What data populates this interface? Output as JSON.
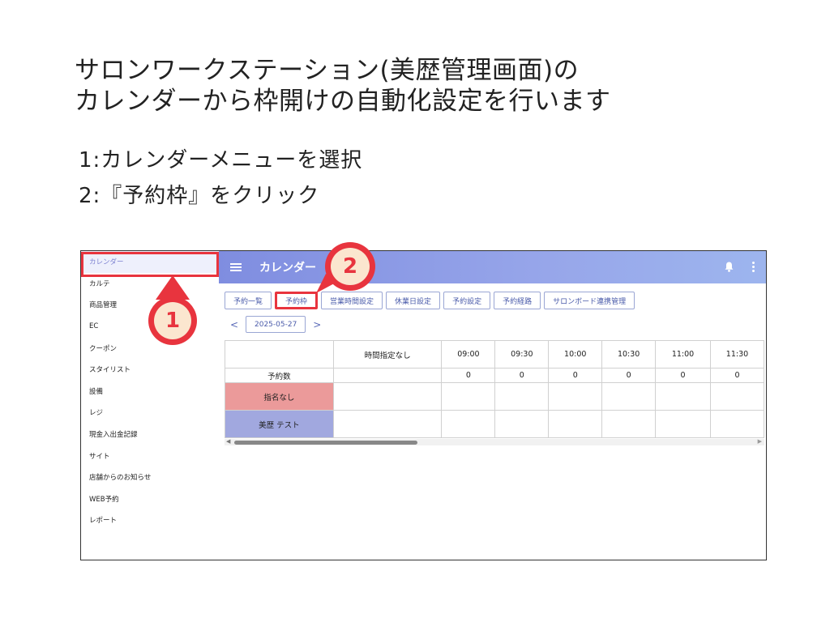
{
  "slide": {
    "title_line1": "サロンワークステーション(美歴管理画面)の",
    "title_line2": "カレンダーから枠開けの自動化設定を行います",
    "step1": "1:カレンダーメニューを選択",
    "step2": "2:『予約枠』をクリック"
  },
  "sidebar": {
    "items": [
      {
        "label": "カレンダー"
      },
      {
        "label": "カルテ"
      },
      {
        "label": "商品管理"
      },
      {
        "label": "EC"
      },
      {
        "label": "クーポン"
      },
      {
        "label": "スタイリスト"
      },
      {
        "label": "設備"
      },
      {
        "label": "レジ"
      },
      {
        "label": "現金入出金記録"
      },
      {
        "label": "サイト"
      },
      {
        "label": "店舗からのお知らせ"
      },
      {
        "label": "WEB予約"
      },
      {
        "label": "レポート"
      }
    ]
  },
  "header": {
    "title": "カレンダー",
    "menu_icon": "hamburger-icon",
    "bell_icon": "bell-icon",
    "more_icon": "kebab-menu-icon",
    "color_start": "#7f8de0",
    "color_end": "#9db5ee"
  },
  "tabs": [
    {
      "label": "予約一覧"
    },
    {
      "label": "予約枠"
    },
    {
      "label": "営業時間設定"
    },
    {
      "label": "休業日設定"
    },
    {
      "label": "予約設定"
    },
    {
      "label": "予約経路"
    },
    {
      "label": "サロンボード連携管理"
    }
  ],
  "datebar": {
    "prev": "<",
    "date": "2025-05-27",
    "next": ">"
  },
  "table": {
    "columns": [
      "時間指定なし",
      "09:00",
      "09:30",
      "10:00",
      "10:30",
      "11:00",
      "11:30"
    ],
    "count_row_label": "予約数",
    "counts": [
      "",
      "0",
      "0",
      "0",
      "0",
      "0",
      "0"
    ],
    "rows": [
      {
        "label": "指名なし",
        "color": "#eb9a9a"
      },
      {
        "label": "美歴 テスト",
        "color": "#a1a8df"
      }
    ]
  },
  "markers": {
    "one": "1",
    "two": "2",
    "color": "#e8343e"
  }
}
